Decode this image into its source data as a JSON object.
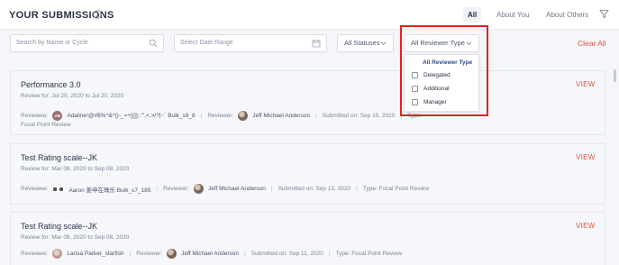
{
  "header": {
    "title": "YOUR SUBMISSIONS",
    "tabs": [
      {
        "label": "All",
        "active": true
      },
      {
        "label": "About You",
        "active": false
      },
      {
        "label": "About Others",
        "active": false
      }
    ]
  },
  "filters": {
    "search_placeholder": "Search by Name or Cycle",
    "date_placeholder": "Select Date Range",
    "status_select": "All Statuses",
    "reviewer_type_select": "All Reviewer Type",
    "clear_label": "Clear All"
  },
  "dropdown": {
    "header": "All Reviewer Type",
    "options": [
      {
        "label": "Delegated",
        "checked": false
      },
      {
        "label": "Additional",
        "checked": false
      },
      {
        "label": "Manager",
        "checked": false
      }
    ]
  },
  "labels": {
    "reviewee": "Reviewee:",
    "reviewer": "Reviewer:",
    "view": "VIEW",
    "type_cut": "Type:"
  },
  "cards": [
    {
      "title": "Performance 3.0",
      "review_for": "Review for: Jul 20, 2020 to Jul 20, 2020",
      "reviewee_initials": "AB",
      "reviewee": "Adaline!@#$%^&*()-_=+[{]};:'\",<.>/?|~` Bulk_s9_8",
      "reviewer": "Jeff Michael Anderson",
      "submitted": "Submitted on: Sep 15, 2020",
      "type_line": "Focal Point Review"
    },
    {
      "title": "Test Rating scale--JK",
      "review_for": "Review for: Mar 08, 2020 to Sep 08, 2020",
      "reviewee": "Aaron 姜申在珠乐 Bulk_s7_185",
      "reviewer": "Jeff Michael Anderson",
      "submitted": "Submitted on: Sep 15, 2020",
      "type": "Type: Focal Point Review"
    },
    {
      "title": "Test Rating scale--JK",
      "review_for": "Review for: Mar 08, 2020 to Sep 08, 2020",
      "reviewee": "Larisa Parker_starfish",
      "reviewer": "Jeff Michael Anderson",
      "submitted": "Submitted on: Sep 11, 2020",
      "type": "Type: Focal Point Review"
    }
  ],
  "colors": {
    "accent": "#e0533d",
    "highlight_box": "#e3201d",
    "background": "#f4f6f9"
  }
}
